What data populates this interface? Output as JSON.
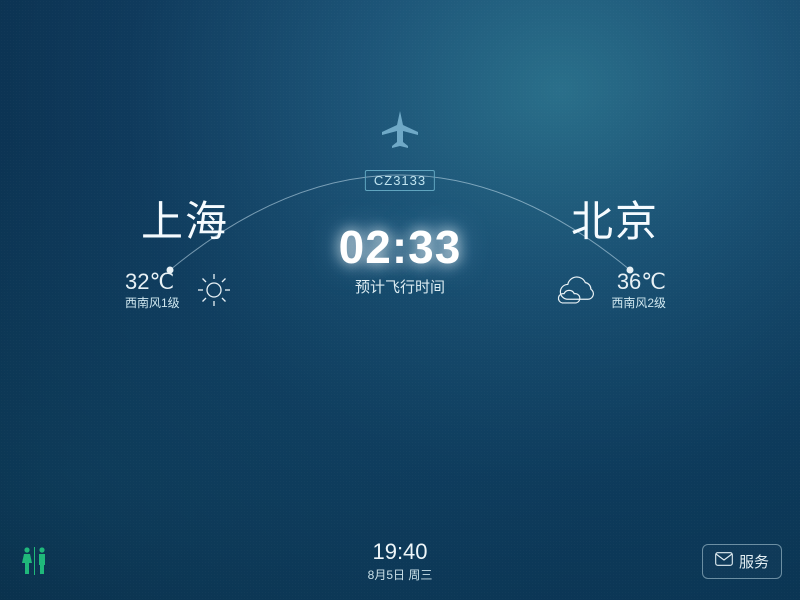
{
  "flight": {
    "number": "CZ3133",
    "origin": {
      "city": "上海",
      "temperature": "32℃",
      "wind": "西南风1级",
      "weather_icon": "sun-icon"
    },
    "destination": {
      "city": "北京",
      "temperature": "36℃",
      "wind": "西南风2级",
      "weather_icon": "cloud-icon"
    },
    "eta": {
      "time": "02:33",
      "label": "预计飞行时间"
    }
  },
  "status_bar": {
    "clock": "19:40",
    "date": "8月5日 周三",
    "service_label": "服务"
  }
}
